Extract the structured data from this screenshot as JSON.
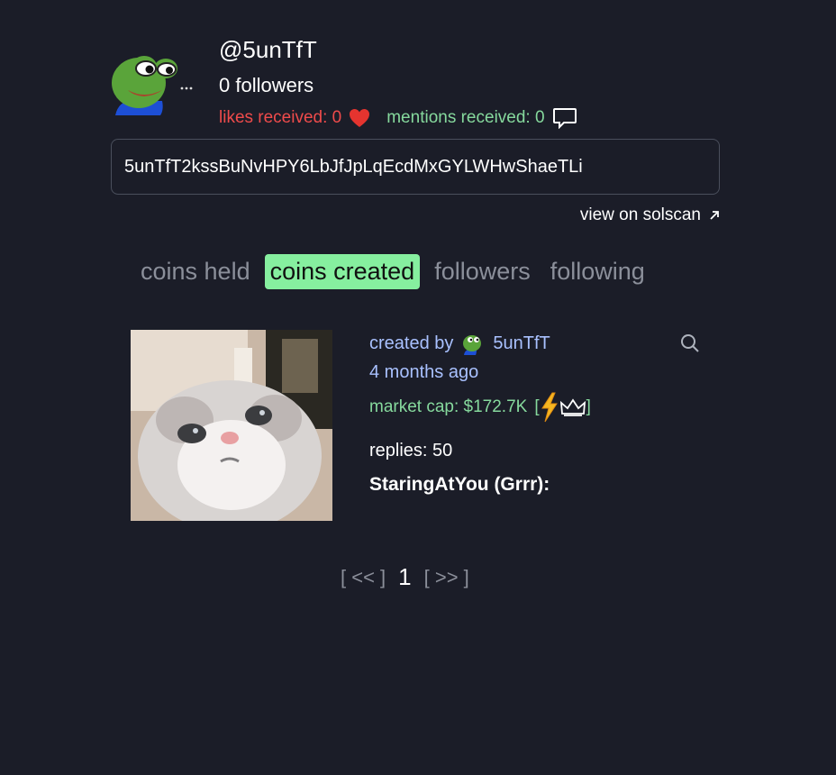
{
  "profile": {
    "username": "@5unTfT",
    "followers": "0 followers",
    "likes_received": "likes received: 0",
    "mentions_received": "mentions received: 0",
    "address": "5unTfT2kssBuNvHPY6LbJfJpLqEcdMxGYLWHwShaeTLi",
    "solscan_link": "view on solscan"
  },
  "tabs": [
    "coins held",
    "coins created",
    "followers",
    "following"
  ],
  "active_tab": "coins created",
  "coin": {
    "created_by_label": "created by",
    "creator": "5unTfT",
    "age": "4 months ago",
    "market_cap": "market cap: $172.7K",
    "replies": "replies: 50",
    "name": "StaringAtYou (Grrr):"
  },
  "pager": {
    "prev": "[ << ]",
    "current": "1",
    "next": "[ >> ]"
  },
  "colors": {
    "background": "#1b1d28",
    "likes": "#ef4b4b",
    "mentions": "#86d99d",
    "active_tab": "#86ef9f",
    "creator_link": "#a9c1ff"
  },
  "icons": [
    "pepe-avatar",
    "heart-icon",
    "speech-bubble-icon",
    "external-link-icon",
    "lightning-icon",
    "crown-icon",
    "search-icon"
  ]
}
